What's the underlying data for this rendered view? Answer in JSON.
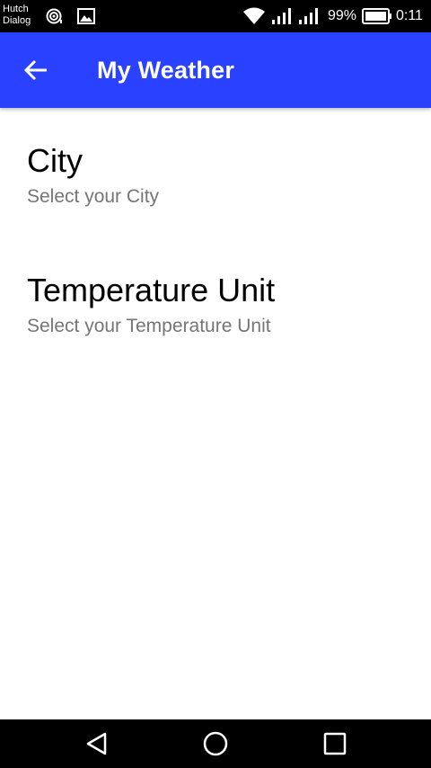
{
  "status_bar": {
    "carrier_line1": "Hutch",
    "carrier_line2": "Dialog",
    "battery_percent": "99%",
    "time": "0:11",
    "icons": [
      "hotspot-icon",
      "image-icon",
      "wifi-icon",
      "signal-icon",
      "signal-icon",
      "battery-icon"
    ]
  },
  "app_bar": {
    "title": "My Weather",
    "back_icon": "arrow-back-icon",
    "color": "#2a42ff"
  },
  "preferences": [
    {
      "title": "City",
      "summary": "Select your City"
    },
    {
      "title": "Temperature Unit",
      "summary": "Select your Temperature Unit"
    }
  ],
  "nav_bar": {
    "buttons": [
      "back-triangle-icon",
      "home-circle-icon",
      "recents-square-icon"
    ]
  }
}
